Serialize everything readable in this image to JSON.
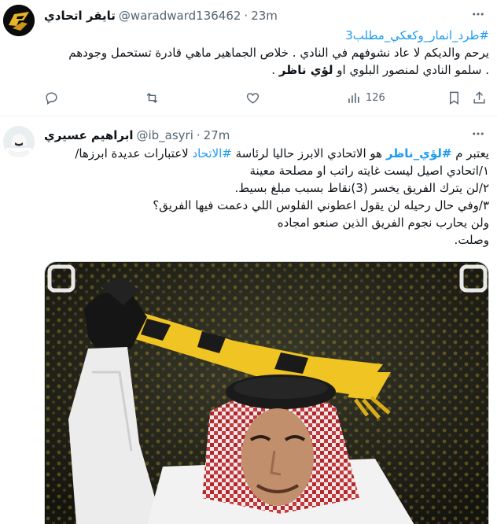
{
  "colors": {
    "accent": "#1d9bf0",
    "text": "#0f1419",
    "muted": "#536471"
  },
  "tweet1": {
    "name": "تايقر اتحادي",
    "handle": "@waradward136462",
    "separator": "·",
    "time": "23m",
    "hashtag": "#طرد_انمار_وكعكي_مطلب3",
    "line2": "يرحم والديكم لا عاد نشوفهم في النادي . خلاص الجماهير ماهي قادرة تستحمل وجودهم",
    "line3_pre": ". سلمو النادي لمنصور البلوي او ",
    "line3_bold": "لؤي ناظر",
    "line3_post": " .",
    "views": "126",
    "icons": [
      "reply-icon",
      "retweet-icon",
      "like-icon",
      "views-icon",
      "bookmark-icon",
      "share-icon",
      "more-icon"
    ]
  },
  "tweet2": {
    "name": "ابراهيم عسيري",
    "handle": "@ib_asyri",
    "separator": "·",
    "time": "27m",
    "l1_a": "يعتبر م ",
    "l1_tag1": "#لؤي_ناظر",
    "l1_b": " هو الاتحادي الابرز حاليا لرئاسة ",
    "l1_tag2": "#الاتحاد",
    "l1_c": " لاعتبارات عديدة ابرزها/",
    "l2": "١/اتحادي اصيل ليست غايته راتب او مصلحة معينة",
    "l3": "٢/لن يترك الفريق يخسر (3)نقاط بسبب مبلغ بسيط.",
    "l4": "٣/وفي حال رحيله لن يقول اعطوني الفلوس اللي دعمت فيها الفريق؟",
    "l5": "ولن يحارب نجوم الفريق الذين صنعو امجاده",
    "l6": "وصلت.",
    "icons": [
      "more-icon"
    ]
  }
}
